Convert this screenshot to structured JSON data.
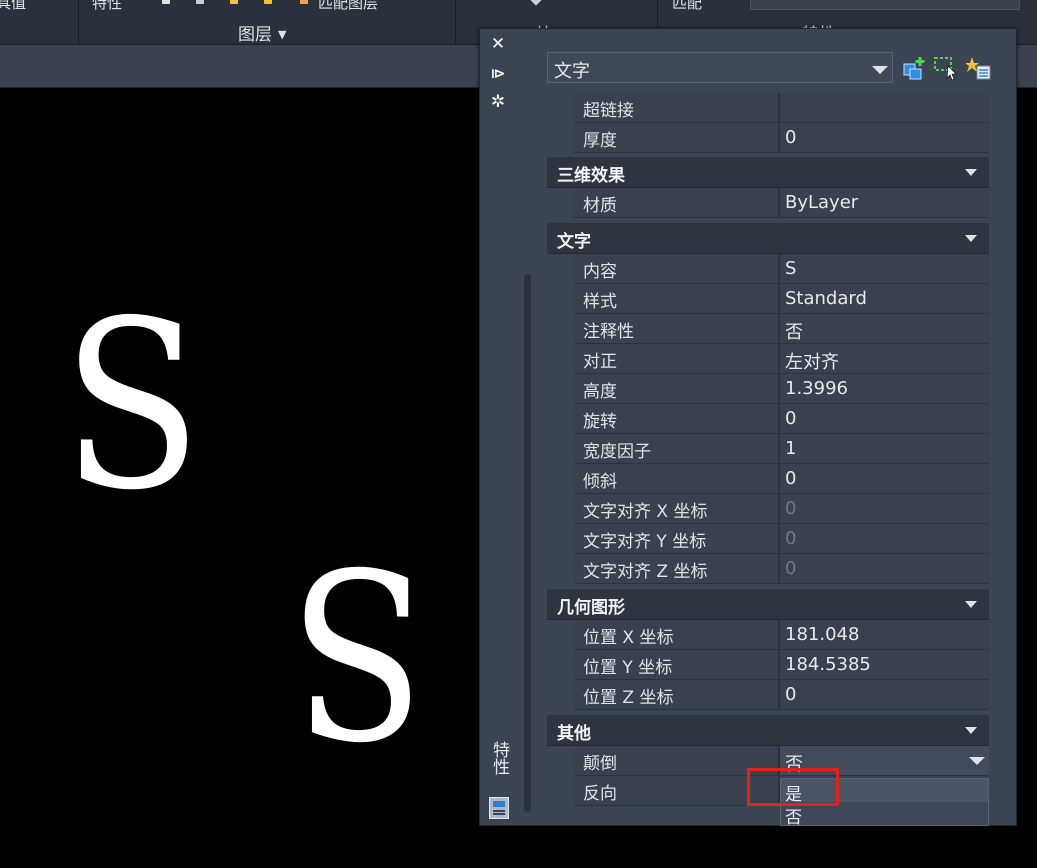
{
  "ribbon": {
    "cut_left": "具值",
    "cut_prop": "特性",
    "cut_tool": "匹配图层",
    "layer_group_label": "图层",
    "block_group_label": "块",
    "match_label": "匹配",
    "utilities_label": "特性"
  },
  "canvas": {
    "text_normal": "S",
    "text_flipped": "S"
  },
  "palette": {
    "strip_title": "特性",
    "object_type": "文字",
    "rows_top": [
      {
        "label": "超链接",
        "value": ""
      },
      {
        "label": "厚度",
        "value": "0"
      }
    ],
    "cat_3d": "三维效果",
    "rows_3d": [
      {
        "label": "材质",
        "value": "ByLayer"
      }
    ],
    "cat_text": "文字",
    "rows_text": [
      {
        "label": "内容",
        "value": "S"
      },
      {
        "label": "样式",
        "value": "Standard"
      },
      {
        "label": "注释性",
        "value": "否"
      },
      {
        "label": "对正",
        "value": "左对齐"
      },
      {
        "label": "高度",
        "value": "1.3996"
      },
      {
        "label": "旋转",
        "value": "0"
      },
      {
        "label": "宽度因子",
        "value": "1"
      },
      {
        "label": "倾斜",
        "value": "0"
      },
      {
        "label": "文字对齐 X 坐标",
        "value": "0"
      },
      {
        "label": "文字对齐 Y 坐标",
        "value": "0"
      },
      {
        "label": "文字对齐 Z 坐标",
        "value": "0"
      }
    ],
    "cat_geom": "几何图形",
    "rows_geom": [
      {
        "label": "位置 X 坐标",
        "value": "181.048"
      },
      {
        "label": "位置 Y 坐标",
        "value": "184.5385"
      },
      {
        "label": "位置 Z 坐标",
        "value": "0"
      }
    ],
    "cat_misc": "其他",
    "rows_misc": [
      {
        "label": "颠倒",
        "value": "否"
      },
      {
        "label": "反向",
        "value": ""
      }
    ],
    "dropdown_options": [
      "是",
      "否"
    ],
    "dropdown_selected": "是"
  },
  "colors": {
    "palette_bg": "#3b4453",
    "category_bg": "#2e3440",
    "highlight": "#e8201a",
    "canvas_bg": "#000000"
  }
}
